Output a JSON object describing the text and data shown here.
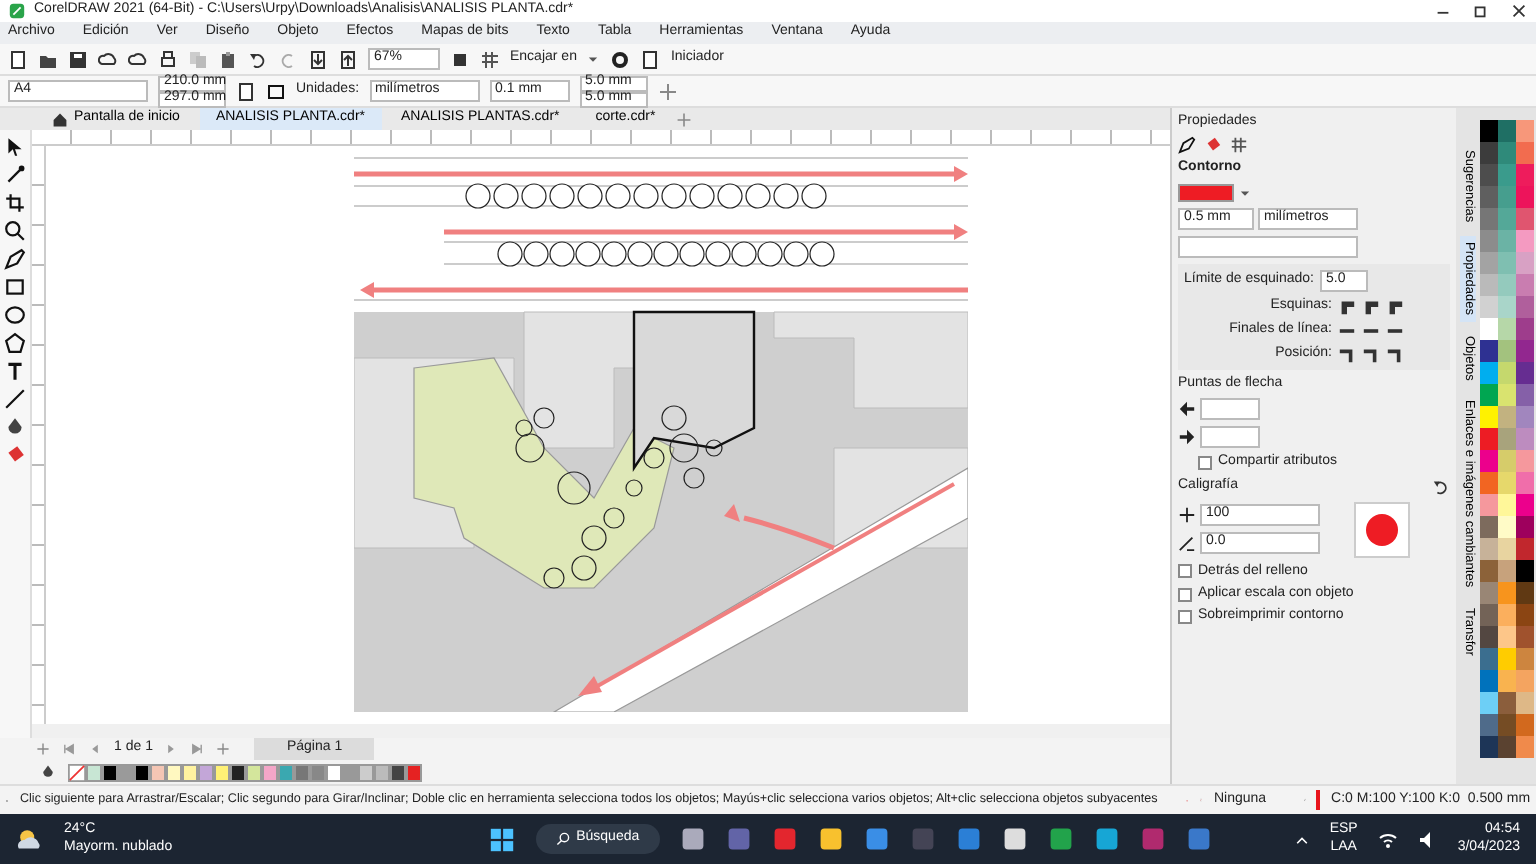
{
  "window": {
    "title": "CorelDRAW 2021 (64-Bit) - C:\\Users\\Urpy\\Downloads\\Analisis\\ANALISIS PLANTA.cdr*"
  },
  "menu": [
    "Archivo",
    "Edición",
    "Ver",
    "Diseño",
    "Objeto",
    "Efectos",
    "Mapas de bits",
    "Texto",
    "Tabla",
    "Herramientas",
    "Ventana",
    "Ayuda"
  ],
  "toolbar": {
    "zoom": "67%",
    "snap": "Encajar en",
    "launcher": "Iniciador"
  },
  "property_bar": {
    "page_size": "A4",
    "width": "210.0 mm",
    "height": "297.0 mm",
    "units_label": "Unidades:",
    "units": "milímetros",
    "nudge": "0.1 mm",
    "dup_x": "5.0 mm",
    "dup_y": "5.0 mm"
  },
  "tabs": [
    {
      "label": "Pantalla de inicio",
      "kind": "home",
      "selected": false
    },
    {
      "label": "ANALISIS PLANTA.cdr*",
      "kind": "document",
      "selected": true
    },
    {
      "label": "ANALISIS PLANTAS.cdr*",
      "kind": "document",
      "selected": false
    },
    {
      "label": "corte.cdr*",
      "kind": "document",
      "selected": false
    }
  ],
  "page_nav": {
    "count": "1 de 1",
    "page_tab": "Página 1"
  },
  "bottom_palette": [
    {
      "color": "#c8e6d4"
    },
    {
      "color": "#000000"
    },
    {
      "color": "#9a9a9a"
    },
    {
      "color": "#000000"
    },
    {
      "color": "#f5c6b4"
    },
    {
      "color": "#fff8c0"
    },
    {
      "color": "#fff3a0"
    },
    {
      "color": "#c3a6d8"
    },
    {
      "color": "#fff176"
    },
    {
      "color": "#222222"
    },
    {
      "color": "#d4e69c"
    },
    {
      "color": "#f4a6c8"
    },
    {
      "color": "#3aa8b0"
    },
    {
      "color": "#777777"
    },
    {
      "color": "#888888"
    },
    {
      "color": "#ffffff"
    },
    {
      "color": "#999999"
    },
    {
      "color": "#cccccc"
    },
    {
      "color": "#bbbbbb"
    },
    {
      "color": "#444444"
    },
    {
      "color": "#e52222"
    }
  ],
  "status_bar": {
    "hint": "Clic siguiente para Arrastrar/Escalar; Clic segundo para Girar/Inclinar; Doble clic en herramienta selecciona todos los objetos; Mayús+clic selecciona varios objetos; Alt+clic selecciona objetos subyacentes",
    "fill": "Ninguna",
    "outline": {
      "text": "C:0 M:100 Y:100 K:0  0.500 mm",
      "color": "#e8141c"
    }
  },
  "properties_panel": {
    "title": "Propiedades",
    "section": "Contorno",
    "color": "#ee1c24",
    "width": "0.5 mm",
    "units": "milímetros",
    "miter_label": "Límite de esquinado:",
    "miter": "5.0",
    "corners_label": "Esquinas:",
    "caps_label": "Finales de línea:",
    "position_label": "Posición:",
    "arrows_label": "Puntas de flecha",
    "share": {
      "label": "Compartir atributos",
      "checked": false
    },
    "calligraphy_label": "Caligrafía",
    "stretch": "100",
    "angle": "0.0",
    "options": [
      {
        "label": "Detrás del relleno",
        "checked": false
      },
      {
        "label": "Aplicar escala con objeto",
        "checked": false
      },
      {
        "label": "Sobreimprimir contorno",
        "checked": false
      }
    ]
  },
  "docker_tabs": [
    {
      "label": "Sugerencias",
      "selected": false
    },
    {
      "label": "Propiedades",
      "selected": true
    },
    {
      "label": "Objetos",
      "selected": false
    },
    {
      "label": "Enlaces e imágenes cambiantes",
      "selected": false
    },
    {
      "label": "Transfor",
      "selected": false
    }
  ],
  "side_palette": [
    {
      "swatches": [
        {
          "color": "#000000"
        },
        {
          "color": "#3c3c3c"
        },
        {
          "color": "#4d4d4d"
        },
        {
          "color": "#5f5f5f"
        },
        {
          "color": "#767676"
        },
        {
          "color": "#8c8c8c"
        },
        {
          "color": "#a3a3a3"
        },
        {
          "color": "#bababa"
        },
        {
          "color": "#d1d1d1"
        },
        {
          "color": "#ffffff"
        },
        {
          "color": "#2e3192"
        },
        {
          "color": "#00aeef"
        },
        {
          "color": "#00a651"
        },
        {
          "color": "#fff200"
        },
        {
          "color": "#ed1c24"
        },
        {
          "color": "#ec008c"
        },
        {
          "color": "#f26522"
        },
        {
          "color": "#f5989d"
        },
        {
          "color": "#7d6b5d"
        },
        {
          "color": "#c7b299"
        },
        {
          "color": "#8c6239"
        },
        {
          "color": "#998675"
        },
        {
          "color": "#736357"
        },
        {
          "color": "#534741"
        },
        {
          "color": "#3b6e8f"
        },
        {
          "color": "#0072bc"
        },
        {
          "color": "#6dcff6"
        },
        {
          "color": "#4f6b8a"
        },
        {
          "color": "#1d3557"
        }
      ]
    },
    {
      "swatches": [
        {
          "color": "#1f6f64"
        },
        {
          "color": "#2f8a7a"
        },
        {
          "color": "#3a9b8c"
        },
        {
          "color": "#469e8e"
        },
        {
          "color": "#54a898"
        },
        {
          "color": "#6bb3a5"
        },
        {
          "color": "#7fbfb1"
        },
        {
          "color": "#94cabd"
        },
        {
          "color": "#a9d5c9"
        },
        {
          "color": "#b6d7a8"
        },
        {
          "color": "#a3c27e"
        },
        {
          "color": "#c5d86d"
        },
        {
          "color": "#d9e36f"
        },
        {
          "color": "#c2b280"
        },
        {
          "color": "#a8a37c"
        },
        {
          "color": "#d6cc6a"
        },
        {
          "color": "#e6d86b"
        },
        {
          "color": "#fff799"
        },
        {
          "color": "#fffbc7"
        },
        {
          "color": "#e8d4a0"
        },
        {
          "color": "#c7a27c"
        },
        {
          "color": "#f7941d"
        },
        {
          "color": "#fbaf5d"
        },
        {
          "color": "#fdc689"
        },
        {
          "color": "#ffcc00"
        },
        {
          "color": "#f9b34f"
        },
        {
          "color": "#8b5e3c"
        },
        {
          "color": "#754c24"
        },
        {
          "color": "#5a4230"
        }
      ]
    },
    {
      "swatches": [
        {
          "color": "#f7977a"
        },
        {
          "color": "#f26c4f"
        },
        {
          "color": "#ee1c5c"
        },
        {
          "color": "#ed145b"
        },
        {
          "color": "#e0556f"
        },
        {
          "color": "#f49ac1"
        },
        {
          "color": "#d8a1c4"
        },
        {
          "color": "#c97db0"
        },
        {
          "color": "#b05f9c"
        },
        {
          "color": "#9e3d8c"
        },
        {
          "color": "#92278f"
        },
        {
          "color": "#662d91"
        },
        {
          "color": "#8560a8"
        },
        {
          "color": "#a186be"
        },
        {
          "color": "#bd8cbf"
        },
        {
          "color": "#f5989d"
        },
        {
          "color": "#f06eaa"
        },
        {
          "color": "#ec008c"
        },
        {
          "color": "#9e005d"
        },
        {
          "color": "#c1272d"
        },
        {
          "color": "#000000"
        },
        {
          "color": "#603913"
        },
        {
          "color": "#8b4513"
        },
        {
          "color": "#a0522d"
        },
        {
          "color": "#cd853f"
        },
        {
          "color": "#f4a460"
        },
        {
          "color": "#deb887"
        },
        {
          "color": "#d2691e"
        },
        {
          "color": "#f08a4b"
        }
      ]
    }
  ],
  "taskbar": {
    "temperature": "24°C",
    "weather": "Mayorm. nublado",
    "search": "Búsqueda",
    "language": "ESP",
    "layout": "LAA",
    "time": "04:54",
    "date": "3/04/2023"
  }
}
